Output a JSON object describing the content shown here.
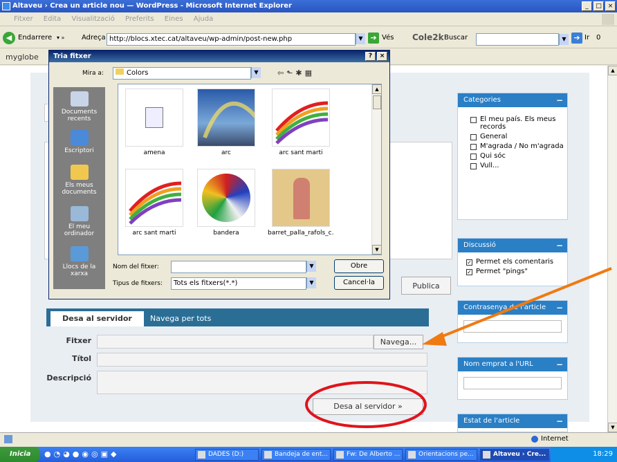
{
  "window": {
    "title": "Altaveu › Crea un article nou — WordPress - Microsoft Internet Explorer",
    "controls": [
      "_",
      "□",
      "×"
    ]
  },
  "menu": [
    "Fitxer",
    "Edita",
    "Visualització",
    "Preferits",
    "Eines",
    "Ajuda"
  ],
  "toolbar": {
    "back_label": "Endarrere",
    "address_label": "Adreça",
    "url": "http://blocs.xtec.cat/altaveu/wp-admin/post-new.php",
    "go_label": "Vés",
    "cole2k_label": "Cole2k",
    "search_label": "Buscar",
    "ir_label": "Ir",
    "ir_count": "0"
  },
  "links_bar": {
    "myglobe": "myglobe"
  },
  "file_dialog": {
    "title": "Tria fitxer",
    "title_buttons": [
      "?",
      "×"
    ],
    "look_in_label": "Mira a:",
    "look_in_value": "Colors",
    "places": [
      {
        "label": "Documents recents",
        "icon": "recent-documents-icon"
      },
      {
        "label": "Escriptori",
        "icon": "desktop-icon"
      },
      {
        "label": "Els meus documents",
        "icon": "my-documents-icon"
      },
      {
        "label": "El meu ordinador",
        "icon": "my-computer-icon"
      },
      {
        "label": "Llocs de la xarxa",
        "icon": "network-places-icon"
      }
    ],
    "files": [
      {
        "name": "amena"
      },
      {
        "name": "arc"
      },
      {
        "name": "arc sant marti"
      },
      {
        "name": "arc sant marti"
      },
      {
        "name": "bandera"
      },
      {
        "name": "barret_palla_rafols_c..."
      }
    ],
    "filename_label": "Nom del fitxer:",
    "filename_value": "",
    "filetype_label": "Tipus de fitxers:",
    "filetype_value": "Tots els fitxers(*.*)",
    "open_button": "Obre",
    "cancel_button": "Cancel·la"
  },
  "sidebar": {
    "categories": {
      "title": "Categories",
      "items": [
        "El meu país. Els meus records",
        "General",
        "M'agrada / No m'agrada",
        "Qui sóc",
        "Vull..."
      ]
    },
    "discussion": {
      "title": "Discussió",
      "items": [
        {
          "label": "Permet els comentaris",
          "checked": true
        },
        {
          "label": "Permet \"pings\"",
          "checked": true
        }
      ]
    },
    "password": {
      "title": "Contrasenya de l'article"
    },
    "slug": {
      "title": "Nom emprat a l'URL"
    },
    "status": {
      "title": "Estat de l'article"
    }
  },
  "editor": {
    "publish_button": "Publica"
  },
  "upload": {
    "tab_upload": "Desa al servidor",
    "tab_browse": "Navega per tots",
    "file_label": "Fitxer",
    "browse_button": "Navega...",
    "title_label": "Títol",
    "description_label": "Descripció",
    "submit_button": "Desa al servidor »"
  },
  "statusbar": {
    "zone": "Internet"
  },
  "taskbar": {
    "start": "Inicia",
    "tasks": [
      {
        "label": "DADES (D:)",
        "active": false
      },
      {
        "label": "Bandeja de ent...",
        "active": false
      },
      {
        "label": "Fw: De Alberto ...",
        "active": false
      },
      {
        "label": "Orientacions pe...",
        "active": false
      },
      {
        "label": "Altaveu › Cre...",
        "active": true
      }
    ],
    "clock": "18:29"
  },
  "colors": {
    "wp_blue": "#2a7fc5",
    "annotation_red": "#e0141b",
    "annotation_orange": "#f07a12"
  }
}
